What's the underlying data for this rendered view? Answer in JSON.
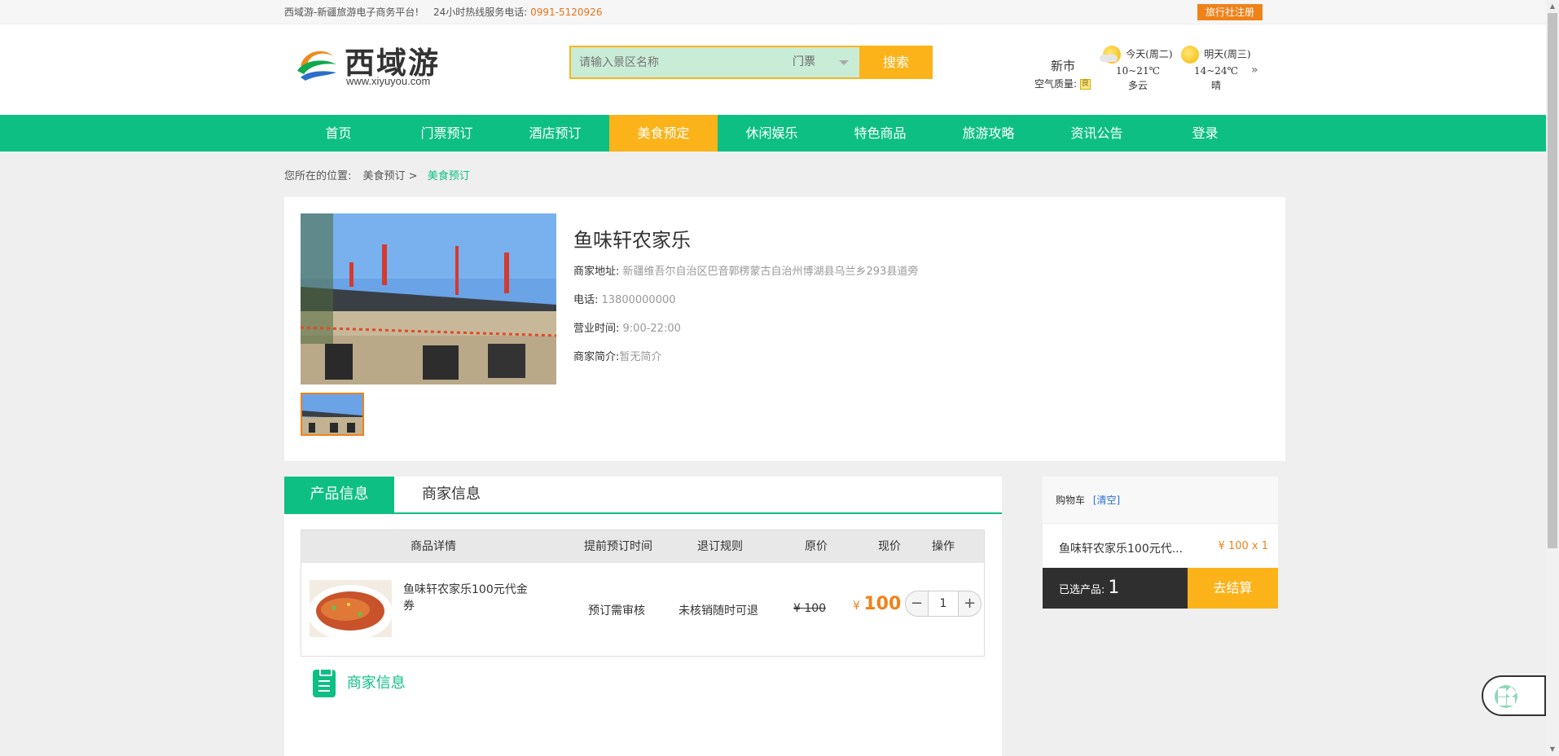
{
  "topbar": {
    "tagline": "西域游-新疆旅游电子商务平台!",
    "hotline_label": "24小时热线服务电话:",
    "hotline_number": "0991-5120926",
    "agency_register": "旅行社注册"
  },
  "header": {
    "logo_text": "西域游",
    "logo_url": "www.xiyuyou.com",
    "search": {
      "placeholder": "请输入景区名称",
      "category": "门票",
      "button": "搜索"
    },
    "weather": {
      "city": "新市",
      "air_label": "空气质量:",
      "air_badge": "良",
      "today": {
        "label": "今天(周二)",
        "temp": "10~21℃",
        "desc": "多云",
        "icon": "partly-cloudy-icon"
      },
      "tomorrow": {
        "label": "明天(周三)",
        "temp": "14~24℃",
        "desc": "晴",
        "icon": "sunny-icon"
      },
      "more": "»"
    }
  },
  "nav": {
    "items": [
      "首页",
      "门票预订",
      "酒店预订",
      "美食预定",
      "休闲娱乐",
      "特色商品",
      "旅游攻略",
      "资讯公告",
      "登录"
    ],
    "active_index": 3
  },
  "breadcrumb": {
    "label": "您所在的位置:",
    "parent": "美食预订 >",
    "current": "美食预订"
  },
  "merchant": {
    "name": "鱼味轩农家乐",
    "address_label": "商家地址:",
    "address": "新疆维吾尔自治区巴音郭楞蒙古自治州博湖县乌兰乡293县道旁",
    "phone_label": "电话:",
    "phone": "13800000000",
    "hours_label": "营业时间:",
    "hours": "9:00-22:00",
    "intro_label": "商家简介:",
    "intro": "暂无简介"
  },
  "product_tabs": [
    "产品信息",
    "商家信息"
  ],
  "table": {
    "headers": [
      "商品详情",
      "提前预订时间",
      "退订规则",
      "原价",
      "现价",
      "操作"
    ],
    "rows": [
      {
        "name": "鱼味轩农家乐100元代金券",
        "advance": "预订需审核",
        "refund": "未核销随时可退",
        "original": "¥ 100",
        "currency": "¥",
        "price": "100",
        "minus": "−",
        "qty": "1",
        "plus": "+"
      }
    ]
  },
  "merchant_section_title": "商家信息",
  "cart": {
    "title": "购物车",
    "clear": "[清空]",
    "item_name": "鱼味轩农家乐100元代...",
    "item_price": "¥ 100 x 1",
    "selected_label": "已选产品:",
    "selected_count": "1",
    "checkout": "去结算"
  },
  "colors": {
    "brand_green": "#0ebf84",
    "accent_orange": "#fbb319",
    "price_orange": "#f0821a"
  }
}
